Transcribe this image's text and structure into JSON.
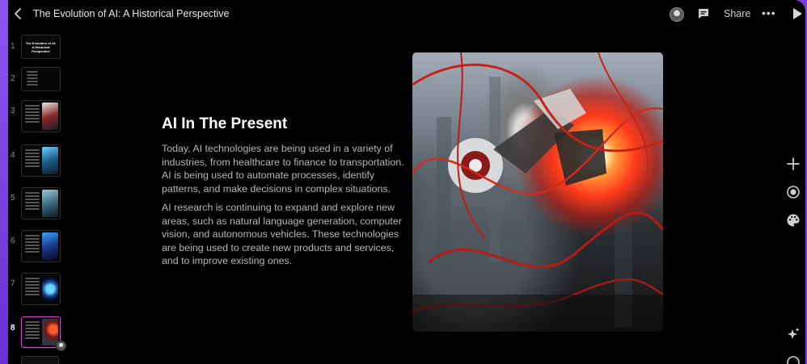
{
  "header": {
    "title": "The Evolution of AI: A Historical Perspective",
    "share_label": "Share",
    "more_label": "•••"
  },
  "thumbnails": [
    {
      "number": "1",
      "title": "The Evolution of AI: A Historical Perspective"
    },
    {
      "number": "2"
    },
    {
      "number": "3"
    },
    {
      "number": "4"
    },
    {
      "number": "5"
    },
    {
      "number": "6"
    },
    {
      "number": "7"
    },
    {
      "number": "8",
      "active": true
    }
  ],
  "slide": {
    "heading": "AI In The Present",
    "paragraphs": [
      "Today, AI technologies are being used in a variety of industries, from healthcare to finance to transportation. AI is being used to automate processes, identify patterns, and make decisions in complex situations.",
      "AI research is continuing to expand and explore new areas, such as natural language generation, computer vision, and autonomous vehicles. These technologies are being used to create new products and services, and to improve existing ones."
    ]
  },
  "colors": {
    "frame_border": "#7b3fe0",
    "background": "#000000",
    "active_thumb_border": "#d447d0"
  },
  "icons": {
    "back": "chevron-left-icon",
    "comment": "comment-icon",
    "play": "play-icon",
    "add": "plus-icon",
    "record": "record-icon",
    "theme": "palette-icon",
    "ai": "sparkle-icon",
    "help": "help-icon"
  }
}
